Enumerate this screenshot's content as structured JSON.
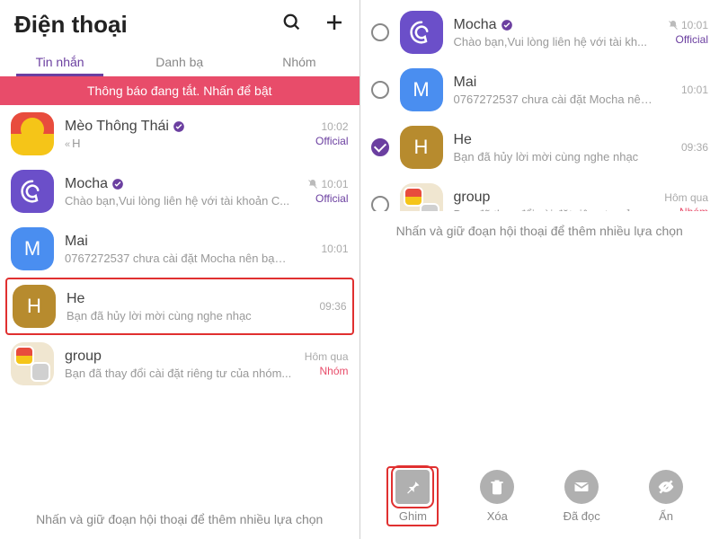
{
  "left": {
    "title": "Điện thoại",
    "tabs": [
      "Tin nhắn",
      "Danh bạ",
      "Nhóm"
    ],
    "activeTab": 0,
    "banner": "Thông báo đang tắt. Nhấn để bật",
    "chats": [
      {
        "name": "Mèo Thông Thái",
        "msg": "H",
        "time": "10:02",
        "label": "Official",
        "avatar": "iron",
        "verified": true,
        "reply": true
      },
      {
        "name": "Mocha",
        "msg": "Chào bạn,Vui lòng liên hệ với tài khoản C...",
        "time": "10:01",
        "label": "Official",
        "avatar": "mocha",
        "verified": true,
        "muted": true
      },
      {
        "name": "Mai",
        "letter": "M",
        "msg": "0767272537 chưa cài đặt Mocha nên bạn khôn...",
        "time": "10:01",
        "avatar": "mai"
      },
      {
        "name": "He",
        "letter": "H",
        "msg": "Bạn đã hủy lời mời cùng nghe nhạc",
        "time": "09:36",
        "avatar": "he",
        "highlighted": true
      },
      {
        "name": "group",
        "msg": "Bạn đã thay đổi cài đặt riêng tư của nhóm...",
        "time": "Hôm qua",
        "label": "Nhóm",
        "labelClass": "group",
        "avatar": "group"
      }
    ],
    "hint": "Nhấn và giữ đoạn hội thoại để thêm nhiều lựa chọn"
  },
  "right": {
    "chats": [
      {
        "name": "Mocha",
        "msg": "Chào bạn,Vui lòng liên hệ với tài kh...",
        "time": "10:01",
        "label": "Official",
        "avatar": "mocha",
        "verified": true,
        "muted": true,
        "checked": false
      },
      {
        "name": "Mai",
        "letter": "M",
        "msg": "0767272537 chưa cài đặt Mocha nên bạ...",
        "time": "10:01",
        "avatar": "mai",
        "checked": false
      },
      {
        "name": "He",
        "letter": "H",
        "msg": "Bạn đã hủy lời mời cùng nghe nhạc",
        "time": "09:36",
        "avatar": "he",
        "checked": true
      },
      {
        "name": "group",
        "msg": "Bạn đã thay đổi cài đặt riêng tư của...",
        "time": "Hôm qua",
        "label": "Nhóm",
        "labelClass": "group",
        "avatar": "group",
        "checked": false
      }
    ],
    "hint": "Nhấn và giữ đoạn hội thoại để thêm nhiều lựa chọn",
    "actions": [
      {
        "label": "Ghim",
        "icon": "pin",
        "highlighted": true
      },
      {
        "label": "Xóa",
        "icon": "trash"
      },
      {
        "label": "Đã đọc",
        "icon": "mail"
      },
      {
        "label": "Ẩn",
        "icon": "eyeoff"
      }
    ]
  }
}
